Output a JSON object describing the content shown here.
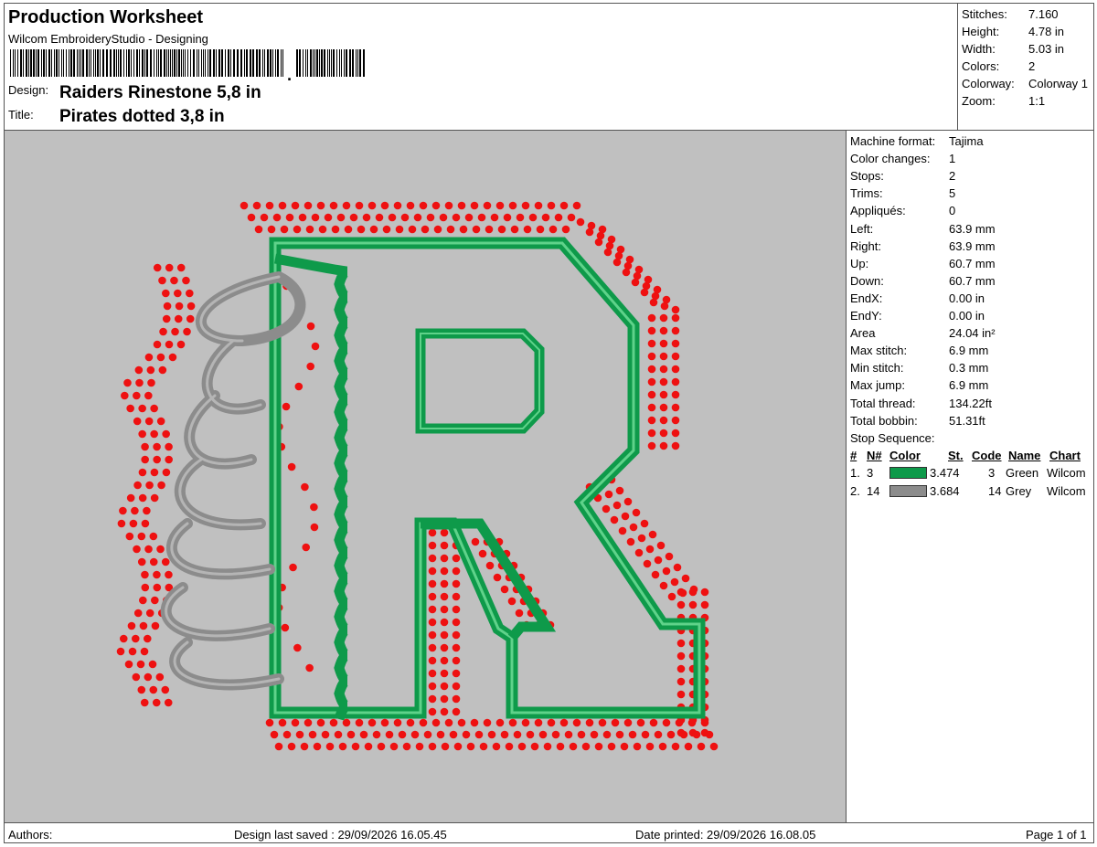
{
  "header": {
    "title": "Production Worksheet",
    "subtitle": "Wilcom EmbroideryStudio - Designing",
    "design_label": "Design:",
    "design_value": "Raiders Rinestone 5,8 in",
    "title_label": "Title:",
    "title_value": "Pirates dotted 3,8 in"
  },
  "stats": [
    {
      "key": "Stitches:",
      "value": "7.160"
    },
    {
      "key": "Height:",
      "value": "4.78 in"
    },
    {
      "key": "Width:",
      "value": "5.03 in"
    },
    {
      "key": "Colors:",
      "value": "2"
    },
    {
      "key": "Colorway:",
      "value": "Colorway 1"
    },
    {
      "key": "Zoom:",
      "value": "1:1"
    }
  ],
  "machine": [
    {
      "key": "Machine format:",
      "value": "Tajima"
    },
    {
      "key": "Color changes:",
      "value": "1"
    },
    {
      "key": "Stops:",
      "value": "2"
    },
    {
      "key": "Trims:",
      "value": "5"
    },
    {
      "key": "Appliqués:",
      "value": "0"
    },
    {
      "key": "Left:",
      "value": "63.9 mm"
    },
    {
      "key": "Right:",
      "value": "63.9 mm"
    },
    {
      "key": "Up:",
      "value": "60.7 mm"
    },
    {
      "key": "Down:",
      "value": "60.7 mm"
    },
    {
      "key": "EndX:",
      "value": "0.00 in"
    },
    {
      "key": "EndY:",
      "value": "0.00 in"
    },
    {
      "key": "Area",
      "value": " 24.04 in²"
    },
    {
      "key": "Max stitch:",
      "value": "6.9 mm"
    },
    {
      "key": "Min stitch:",
      "value": "0.3 mm"
    },
    {
      "key": "Max jump:",
      "value": "6.9 mm"
    },
    {
      "key": "Total thread:",
      "value": "134.22ft"
    },
    {
      "key": "Total bobbin:",
      "value": "51.31ft"
    },
    {
      "key": "Stop Sequence:",
      "value": ""
    }
  ],
  "stop_sequence": {
    "headers": [
      "#",
      "N#",
      "Color",
      "St.",
      "Code",
      "Name",
      "Chart"
    ],
    "rows": [
      {
        "num": "1.",
        "n": "3",
        "color": "#0e9a4a",
        "st": "3.474",
        "code": "3",
        "name": "Green",
        "chart": "Wilcom"
      },
      {
        "num": "2.",
        "n": "14",
        "color": "#8c8c8c",
        "st": "3.684",
        "code": "14",
        "name": "Grey",
        "chart": "Wilcom"
      }
    ]
  },
  "footer": {
    "authors": "Authors:",
    "saved": "Design last saved : 29/09/2026 16.05.45",
    "printed": "Date printed: 29/09/2026 16.08.05",
    "page": "Page 1 of 1"
  },
  "design_colors": {
    "background": "#c0c0c0",
    "rhinestone": "#ee1111",
    "letter_outline": "#0e9a4a",
    "script": "#8c8c8c"
  }
}
